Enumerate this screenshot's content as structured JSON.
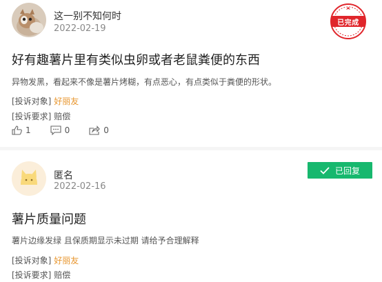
{
  "posts": [
    {
      "username": "这一别不知何时",
      "date": "2022-02-19",
      "title": "好有趣薯片里有类似虫卵或者老鼠粪便的东西",
      "content": "异物发黑，看起来不像是薯片烤糊，有点恶心，有点类似于粪便的形状。",
      "target_label": "[投诉对象]",
      "target_value": "好丽友",
      "request_label": "[投诉要求]",
      "request_value": "赔偿",
      "status": "已完成",
      "likes": "1",
      "comments": "0",
      "shares": "0"
    },
    {
      "username": "匿名",
      "date": "2022-02-16",
      "title": "薯片质量问题",
      "content": "薯片边缘发绿 且保质期显示未过期 请给予合理解释",
      "target_label": "[投诉对象]",
      "target_value": "好丽友",
      "request_label": "[投诉要求]",
      "request_value": "赔偿",
      "status": "已回复"
    }
  ],
  "colors": {
    "accent_link": "#e8962e",
    "completed_stamp": "#e0252b",
    "replied_badge": "#17b86e"
  },
  "icons": [
    "thumbs-up-icon",
    "comment-icon",
    "share-icon",
    "check-icon"
  ]
}
